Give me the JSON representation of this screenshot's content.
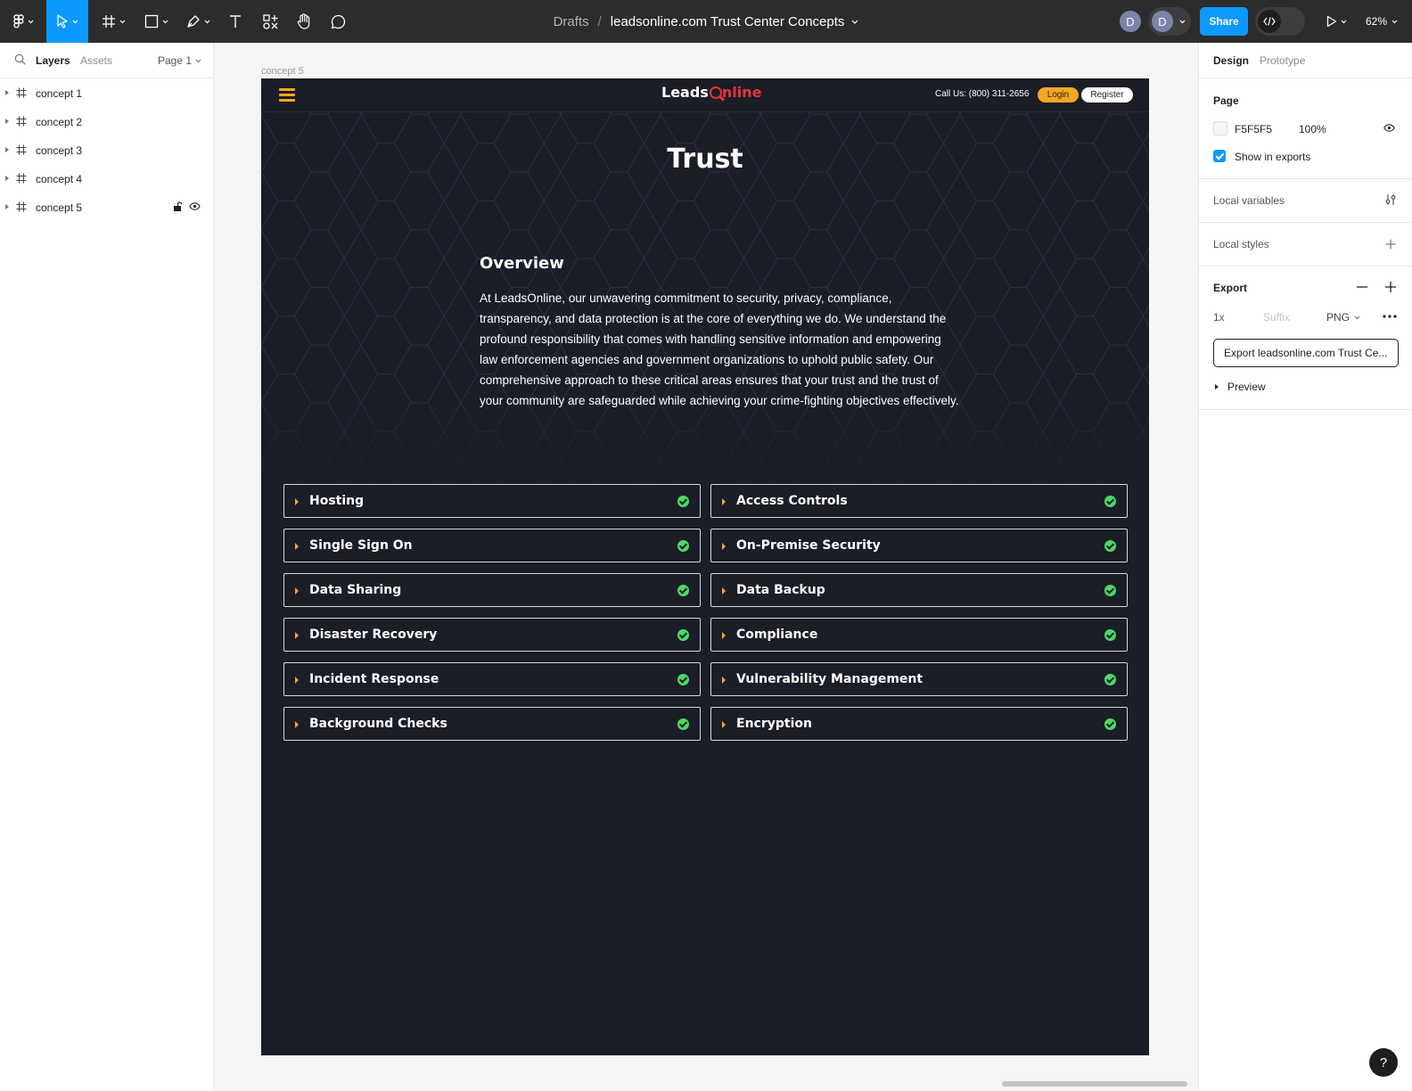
{
  "toolbar": {
    "breadcrumb_drafts": "Drafts",
    "breadcrumb_sep": "/",
    "file_name": "leadsonline.com Trust Center Concepts",
    "avatar_1": "D",
    "avatar_2": "D",
    "share_label": "Share",
    "zoom": "62%",
    "accent": "#0d99ff"
  },
  "left_panel": {
    "tab_layers": "Layers",
    "tab_assets": "Assets",
    "page_selector": "Page 1",
    "layers": [
      "concept 1",
      "concept 2",
      "concept 3",
      "concept 4",
      "concept 5"
    ]
  },
  "canvas": {
    "frame_label": "concept 5"
  },
  "site": {
    "logo_left": "Leads",
    "logo_right": "nline",
    "call_us": "Call Us: (800) 311-2656",
    "login": "Login",
    "register": "Register",
    "title": "Trust",
    "overview_title": "Overview",
    "overview_body": "At LeadsOnline, our unwavering commitment to security, privacy, compliance, transparency, and data protection is at the core of everything we do. We understand the profound responsibility that comes with handling sensitive information and empowering law enforcement agencies and government organizations to uphold public safety. Our comprehensive approach to these critical areas ensures that your trust and the trust of your community are safeguarded while achieving your crime-fighting objectives effectively.",
    "accordion": [
      "Hosting",
      "Access Controls",
      "Single Sign On",
      "On-Premise Security",
      "Data Sharing",
      "Data Backup",
      "Disaster Recovery",
      "Compliance",
      "Incident Response",
      "Vulnerability Management",
      "Background Checks",
      "Encryption"
    ],
    "colors": {
      "background": "#1b1d27",
      "accent": "#f5a623",
      "logo_red": "#e8343a",
      "check": "#4cd964"
    }
  },
  "right_panel": {
    "tab_design": "Design",
    "tab_prototype": "Prototype",
    "page_heading": "Page",
    "page_color": "F5F5F5",
    "page_opacity": "100%",
    "show_in_exports": "Show in exports",
    "local_variables": "Local variables",
    "local_styles": "Local styles",
    "export_heading": "Export",
    "export_scale": "1x",
    "export_suffix_placeholder": "Suffix",
    "export_format": "PNG",
    "export_button": "Export leadsonline.com Trust Ce...",
    "preview": "Preview"
  },
  "help": "?"
}
